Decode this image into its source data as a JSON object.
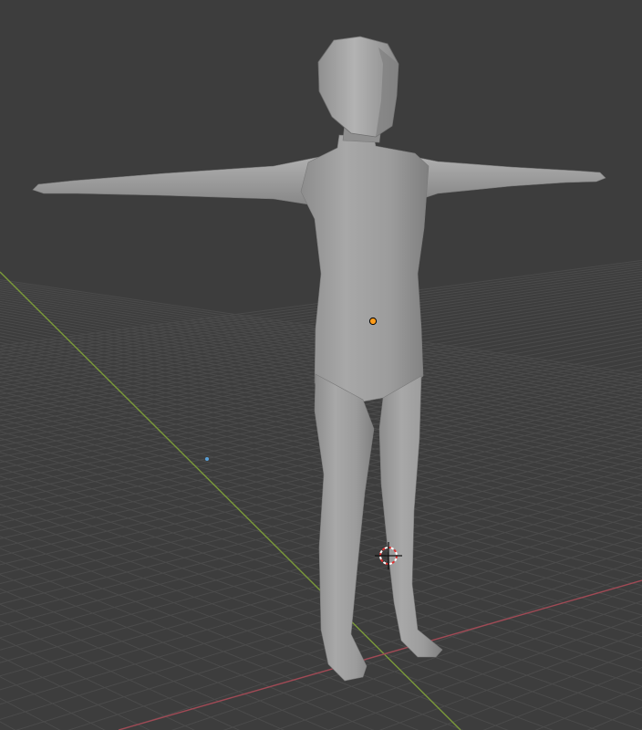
{
  "viewport": {
    "background_color": "#3d3d3d",
    "grid_color": "#4b4b4b",
    "x_axis_color": "#a04a55",
    "y_axis_color": "#7b9a3a",
    "mesh_color": "#9a9a9a",
    "origin_color": "#ff9c1a",
    "light_color": "#5aa0d8",
    "cursor_ring_color": "#e03030"
  },
  "objects": {
    "mesh": {
      "icon": "humanoid-mesh",
      "selected": false
    },
    "origin_point": {
      "icon": "object-origin-dot"
    },
    "light": {
      "icon": "light-point-dot"
    },
    "cursor": {
      "icon": "3d-cursor-crosshair"
    }
  }
}
